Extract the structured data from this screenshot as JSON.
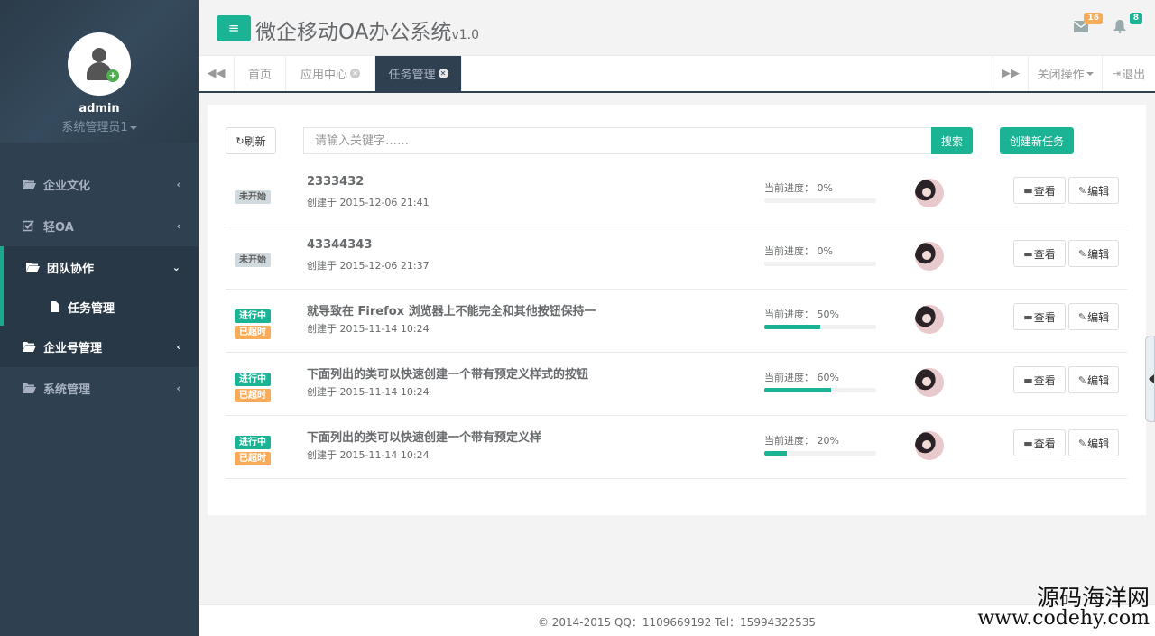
{
  "app": {
    "title": "微企移动OA办公系统",
    "version": "v1.0",
    "mail_count": "16",
    "notify_count": "8"
  },
  "user": {
    "name": "admin",
    "role": "系统管理员1"
  },
  "sidebar": {
    "items": [
      {
        "label": "企业文化"
      },
      {
        "label": "轻OA"
      },
      {
        "label": "团队协作"
      },
      {
        "label": "任务管理"
      },
      {
        "label": "企业号管理"
      },
      {
        "label": "系统管理"
      }
    ]
  },
  "tabs": {
    "items": [
      {
        "label": "首页"
      },
      {
        "label": "应用中心"
      },
      {
        "label": "任务管理"
      }
    ],
    "close_ops": "关闭操作",
    "logout": "退出"
  },
  "toolbar": {
    "refresh": "刷新",
    "search_placeholder": "请输入关键字……",
    "search": "搜索",
    "create": "创建新任务"
  },
  "tasks": [
    {
      "status": "未开始",
      "overdue": "",
      "title": "2333432",
      "date": "创建于 2015-12-06 21:41",
      "progress_label": "当前进度： 0%",
      "progress": 0
    },
    {
      "status": "未开始",
      "overdue": "",
      "title": "43344343",
      "date": "创建于 2015-12-06 21:37",
      "progress_label": "当前进度： 0%",
      "progress": 0
    },
    {
      "status": "进行中",
      "overdue": "已超时",
      "title": "就导致在 Firefox 浏览器上不能完全和其他按钮保持一",
      "date": "创建于 2015-11-14 10:24",
      "progress_label": "当前进度： 50%",
      "progress": 50
    },
    {
      "status": "进行中",
      "overdue": "已超时",
      "title": "下面列出的类可以快速创建一个带有预定义样式的按钮",
      "date": "创建于 2015-11-14 10:24",
      "progress_label": "当前进度： 60%",
      "progress": 60
    },
    {
      "status": "进行中",
      "overdue": "已超时",
      "title": "下面列出的类可以快速创建一个带有预定义样",
      "date": "创建于 2015-11-14 10:24",
      "progress_label": "当前进度： 20%",
      "progress": 20
    }
  ],
  "row_actions": {
    "view": "查看",
    "edit": "编辑"
  },
  "footer": {
    "text": "© 2014-2015   QQ：1109669192   Tel：15994322535"
  },
  "watermark": {
    "line1": "源码海洋网",
    "line2": "www.codehy.com"
  },
  "colors": {
    "primary": "#1ab394",
    "sidebar": "#2f4050",
    "warning": "#f8ac59"
  }
}
